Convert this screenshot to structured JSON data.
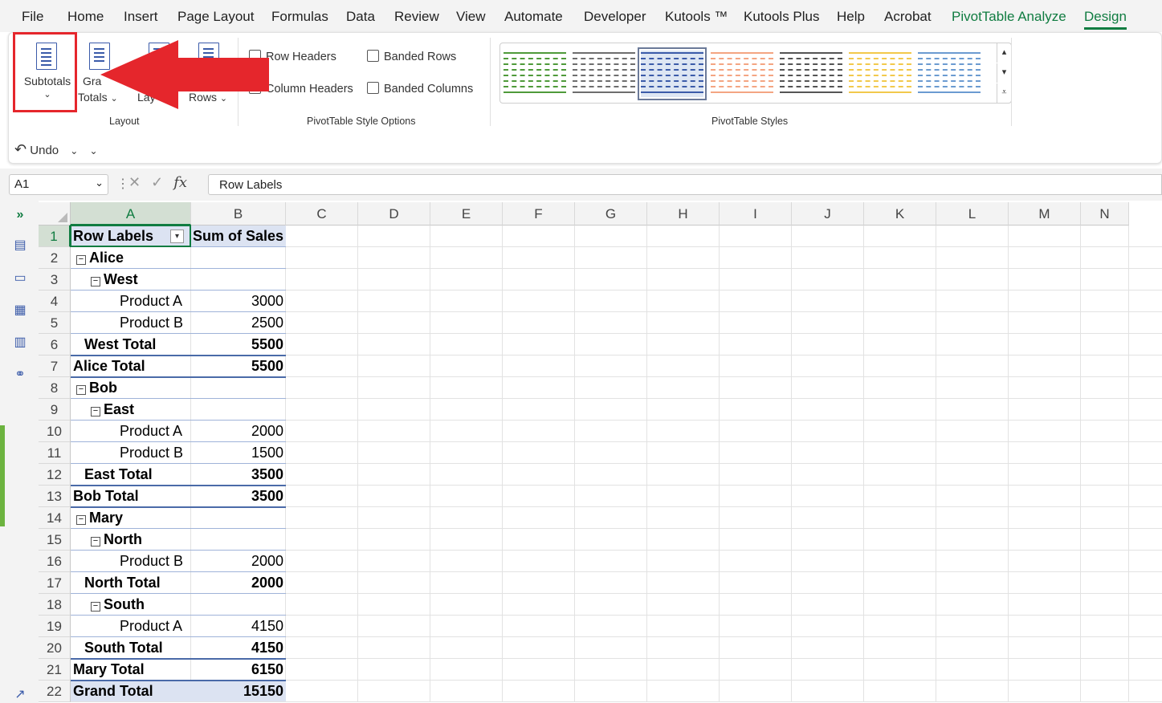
{
  "menu": {
    "tabs": [
      "File",
      "Home",
      "Insert",
      "Page Layout",
      "Formulas",
      "Data",
      "Review",
      "View",
      "Automate",
      "Developer",
      "Kutools ™",
      "Kutools Plus",
      "Help",
      "Acrobat",
      "PivotTable Analyze",
      "Design"
    ]
  },
  "ribbon": {
    "layout": {
      "subtotals": "Subtotals",
      "grand_totals_top": "Gra",
      "grand_totals": "Totals",
      "report_layout": "Lay",
      "blank_rows": "Rows",
      "group_label": "Layout"
    },
    "style_options": {
      "row_headers": "Row Headers",
      "column_headers": "Column Headers",
      "banded_rows": "Banded Rows",
      "banded_columns": "Banded Columns",
      "group_label": "PivotTable Style Options"
    },
    "styles": {
      "group_label": "PivotTable Styles",
      "swatch_colors": [
        "#4f9a3a",
        "#6e6e6e",
        "#3b5ba9",
        "#f4a582",
        "#555555",
        "#f2c94c",
        "#6b9bd1"
      ]
    }
  },
  "undo": {
    "label": "Undo"
  },
  "formula_bar": {
    "name_box": "A1",
    "fx": "fx",
    "value": "Row Labels"
  },
  "sheet": {
    "columns": [
      "A",
      "B",
      "C",
      "D",
      "E",
      "F",
      "G",
      "H",
      "I",
      "J",
      "K",
      "L",
      "M",
      "N"
    ],
    "rows": [
      "1",
      "2",
      "3",
      "4",
      "5",
      "6",
      "7",
      "8",
      "9",
      "10",
      "11",
      "12",
      "13",
      "14",
      "15",
      "16",
      "17",
      "18",
      "19",
      "20",
      "21",
      "22"
    ],
    "pivot": [
      {
        "label": "Row Labels",
        "value": "Sum of Sales"
      },
      {
        "label": "Alice",
        "value": ""
      },
      {
        "label": "West",
        "value": ""
      },
      {
        "label": "Product A",
        "value": "3000"
      },
      {
        "label": "Product B",
        "value": "2500"
      },
      {
        "label": "West Total",
        "value": "5500"
      },
      {
        "label": "Alice Total",
        "value": "5500"
      },
      {
        "label": "Bob",
        "value": ""
      },
      {
        "label": "East",
        "value": ""
      },
      {
        "label": "Product A",
        "value": "2000"
      },
      {
        "label": "Product B",
        "value": "1500"
      },
      {
        "label": "East Total",
        "value": "3500"
      },
      {
        "label": "Bob Total",
        "value": "3500"
      },
      {
        "label": "Mary",
        "value": ""
      },
      {
        "label": "North",
        "value": ""
      },
      {
        "label": "Product B",
        "value": "2000"
      },
      {
        "label": "North Total",
        "value": "2000"
      },
      {
        "label": "South",
        "value": ""
      },
      {
        "label": "Product A",
        "value": "4150"
      },
      {
        "label": "South Total",
        "value": "4150"
      },
      {
        "label": "Mary Total",
        "value": "6150"
      },
      {
        "label": "Grand Total",
        "value": "15150"
      }
    ]
  },
  "annotation": {
    "arrow_color": "#e5262c"
  }
}
